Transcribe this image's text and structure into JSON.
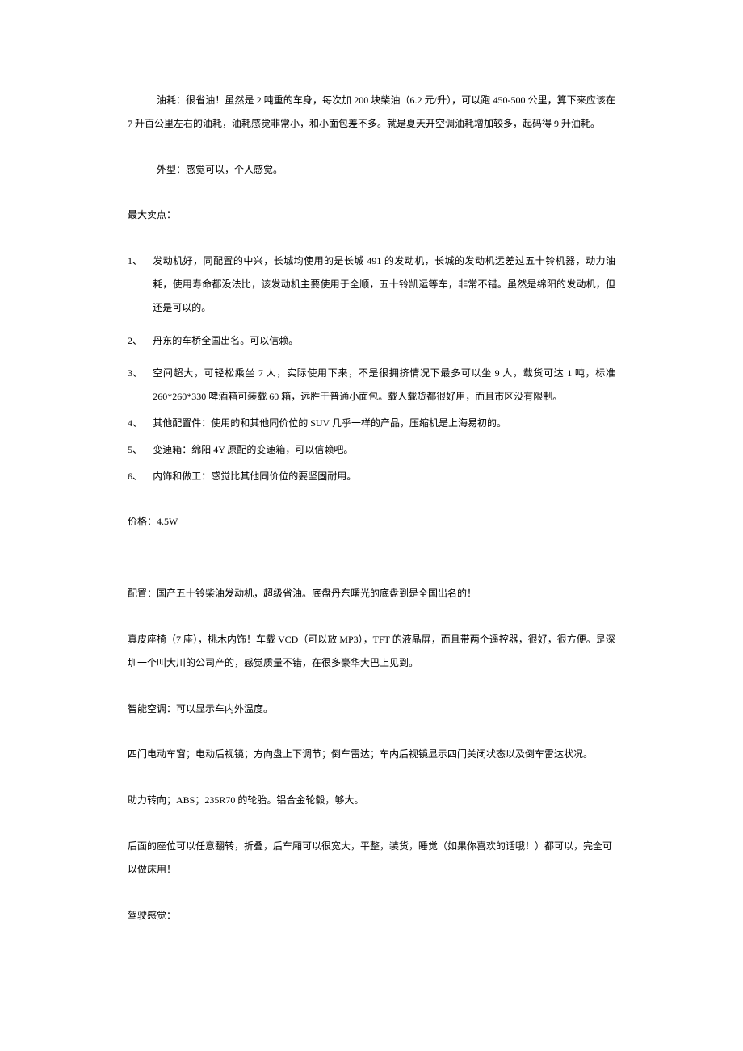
{
  "fuel": "油耗：很省油！虽然是 2 吨重的车身，每次加 200 块柴油（6.2 元/升），可以跑 450-500 公里，算下来应该在 7 升百公里左右的油耗，油耗感觉非常小，和小面包差不多。就是夏天开空调油耗增加较多，起码得 9 升油耗。",
  "appearance": "外型：感觉可以，个人感觉。",
  "selling_points_title": "最大卖点：",
  "selling_points": [
    {
      "num": "1、",
      "text": "发动机好，同配置的中兴，长城均使用的是长城 491 的发动机，长城的发动机远差过五十铃机器，动力油耗，使用寿命都没法比，该发动机主要使用于全顺，五十铃凯运等车，非常不错。虽然是绵阳的发动机，但还是可以的。"
    },
    {
      "num": "2、",
      "text": "丹东的车桥全国出名。可以信赖。"
    },
    {
      "num": "3、",
      "text": "空间超大，可轻松乘坐 7 人，实际使用下来，不是很拥挤情况下最多可以坐 9 人，载货可达 1 吨，标准 260*260*330 啤酒箱可装载 60 箱，远胜于普通小面包。载人载货都很好用，而且市区没有限制。"
    },
    {
      "num": "4、",
      "text": "其他配置件：使用的和其他同价位的 SUV 几乎一样的产品，压缩机是上海易初的。"
    },
    {
      "num": "5、",
      "text": "变速箱：绵阳 4Y 原配的变速箱，可以信赖吧。"
    },
    {
      "num": "6、",
      "text": "内饰和做工：感觉比其他同价位的要坚固耐用。"
    }
  ],
  "price": "价格：4.5W",
  "config": "配置：国产五十铃柴油发动机，超级省油。底盘丹东曙光的底盘到是全国出名的！",
  "seats": "真皮座椅（7 座），桃木内饰！车载 VCD（可以放 MP3），TFT 的液晶屏，而且带两个遥控器，很好，很方便。是深圳一个叫大川的公司产的，感觉质量不错，在很多豪华大巴上见到。",
  "ac": "智能空调：可以显示车内外温度。",
  "windows": "四门电动车窗；电动后视镜；方向盘上下调节；倒车雷达；车内后视镜显示四门关闭状态以及倒车雷达状况。",
  "steering": "助力转向；ABS；235R70 的轮胎。铝合金轮毂，够大。",
  "rear_seats": "后面的座位可以任意翻转，折叠，后车厢可以很宽大，平整，装货，睡觉（如果你喜欢的话哦！）都可以，完全可以做床用！",
  "driving": "驾驶感觉："
}
